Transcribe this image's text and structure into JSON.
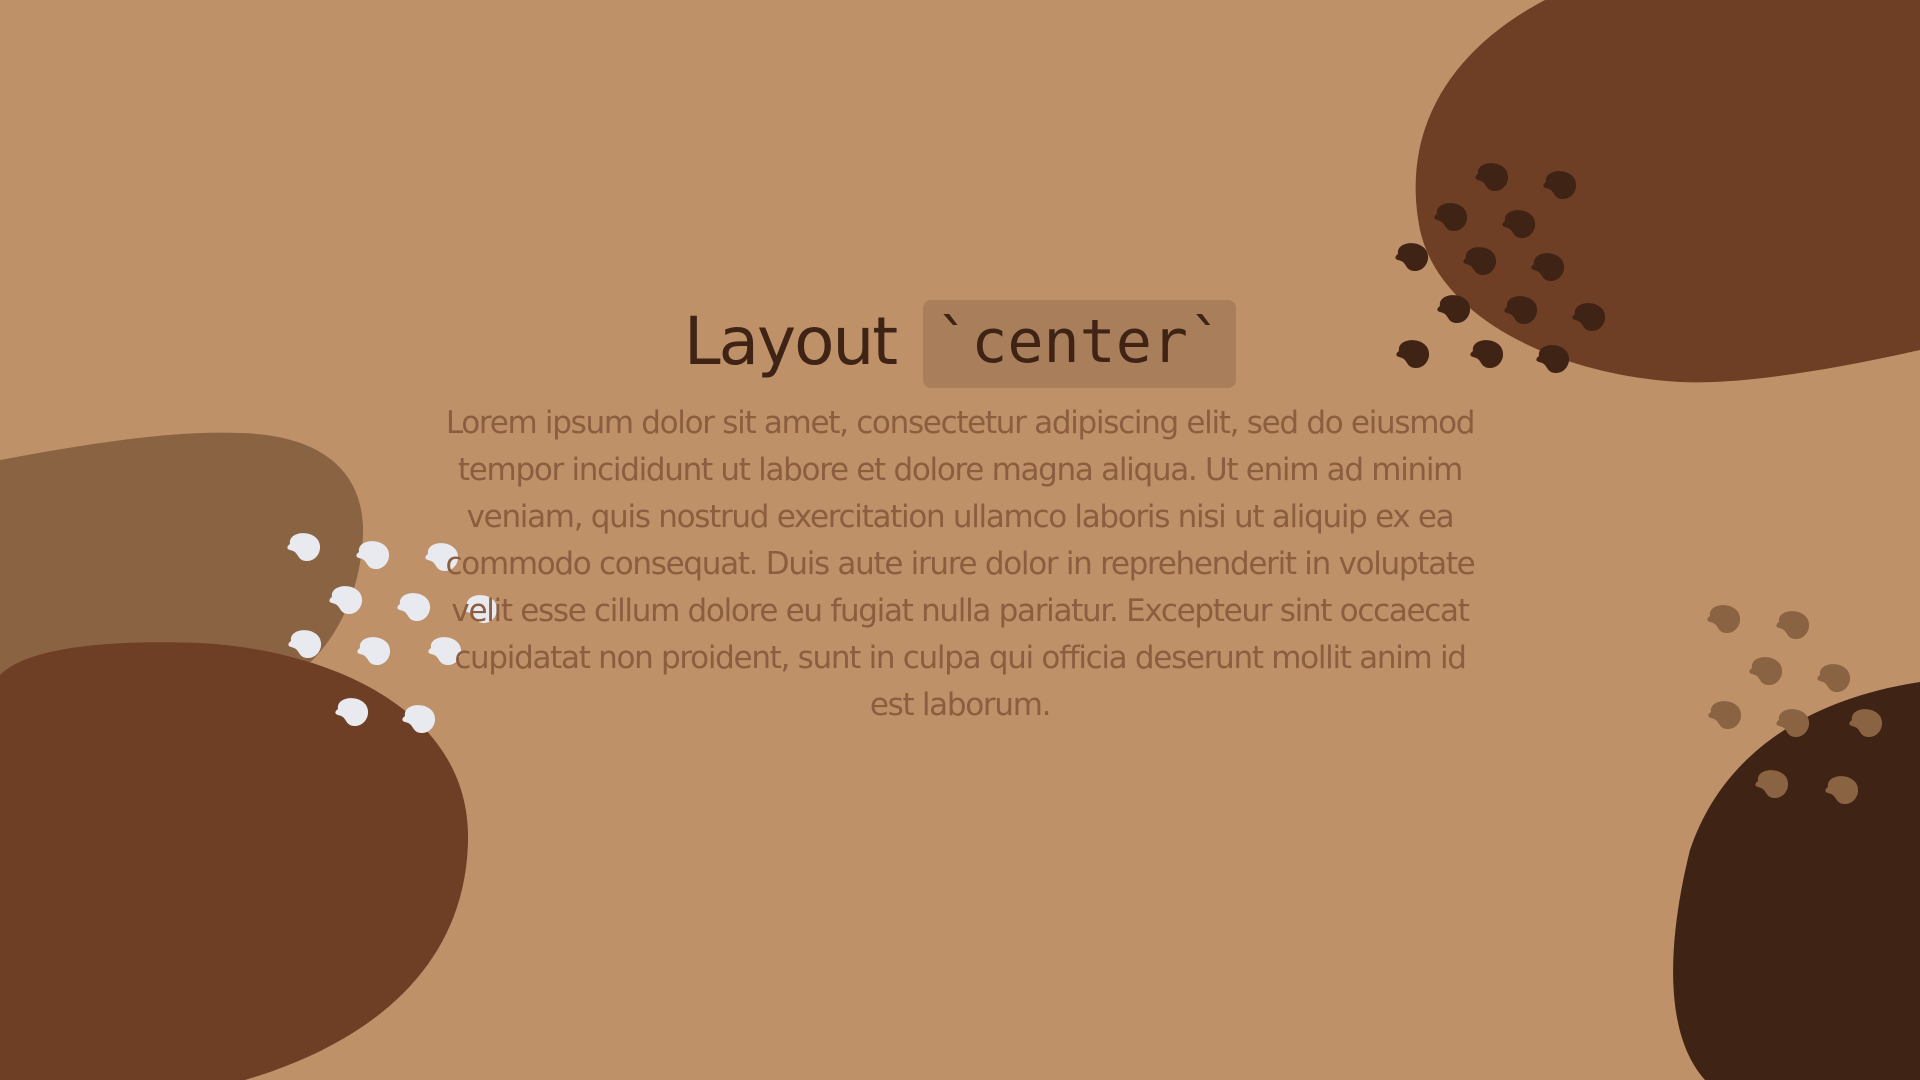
{
  "slide": {
    "title_word": "Layout",
    "title_code": "`center`",
    "paragraph": "Lorem ipsum dolor sit amet, consectetur adipiscing elit, sed do eiusmod tempor incididunt ut labore et dolore magna aliqua. Ut enim ad minim veniam, quis nostrud exercitation ullamco laboris nisi ut aliquip ex ea commodo consequat. Duis aute irure dolor in reprehenderit in voluptate velit esse cillum dolore eu fugiat nulla pariatur. Excepteur sint occaecat cupidatat non proident, sunt in culpa qui officia deserunt mollit anim id est laborum."
  },
  "colors": {
    "background": "#BF9169",
    "blob_dark_brown": "#6E3E25",
    "blob_medium_brown": "#8A6343",
    "blob_darkest_brown": "#3F2315",
    "dots_white": "#E8EAF0",
    "dots_dark": "#3F2315",
    "dots_medium": "#8A6343",
    "title_text": "#3F2315",
    "body_text": "#8A5E3F",
    "code_chip_bg": "#A87E5B"
  }
}
